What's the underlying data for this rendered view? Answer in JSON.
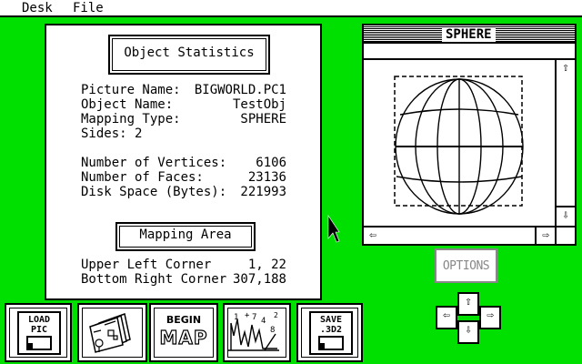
{
  "menu": [
    "Desk",
    "File"
  ],
  "stats": {
    "title": "Object Statistics",
    "rows1": [
      {
        "k": "Picture Name:",
        "v": "BIGWORLD.PC1"
      },
      {
        "k": "Object Name:",
        "v": "TestObj"
      },
      {
        "k": "Mapping Type:",
        "v": "SPHERE"
      },
      {
        "k": "Sides: 2",
        "v": ""
      }
    ],
    "rows2": [
      {
        "k": "Number of Vertices:",
        "v": "6106"
      },
      {
        "k": "Number of Faces:",
        "v": "23136"
      },
      {
        "k": "Disk Space (Bytes):",
        "v": "221993"
      }
    ],
    "mapping_title": "Mapping Area",
    "rows3": [
      {
        "k": "Upper Left Corner",
        "v": "1, 22"
      },
      {
        "k": "Bottom Right Corner",
        "v": "307,188"
      }
    ]
  },
  "sphere_window": {
    "title": "SPHERE",
    "up_arrow": "⇧",
    "down_arrow": "⇩",
    "left_arrow": "⇦",
    "right_arrow": "⇨"
  },
  "options_label": "OPTIONS",
  "pad": {
    "up": "⇧",
    "down": "⇩",
    "left": "⇦",
    "right": "⇨"
  },
  "toolbar": {
    "load_pic": [
      "LOAD",
      "PIC"
    ],
    "begin_map": [
      "BEGIN",
      "MAP"
    ],
    "stats_text": [
      "1",
      "4",
      "7",
      "2",
      "8"
    ],
    "save_3d2": [
      "SAVE",
      ".3D2"
    ]
  }
}
